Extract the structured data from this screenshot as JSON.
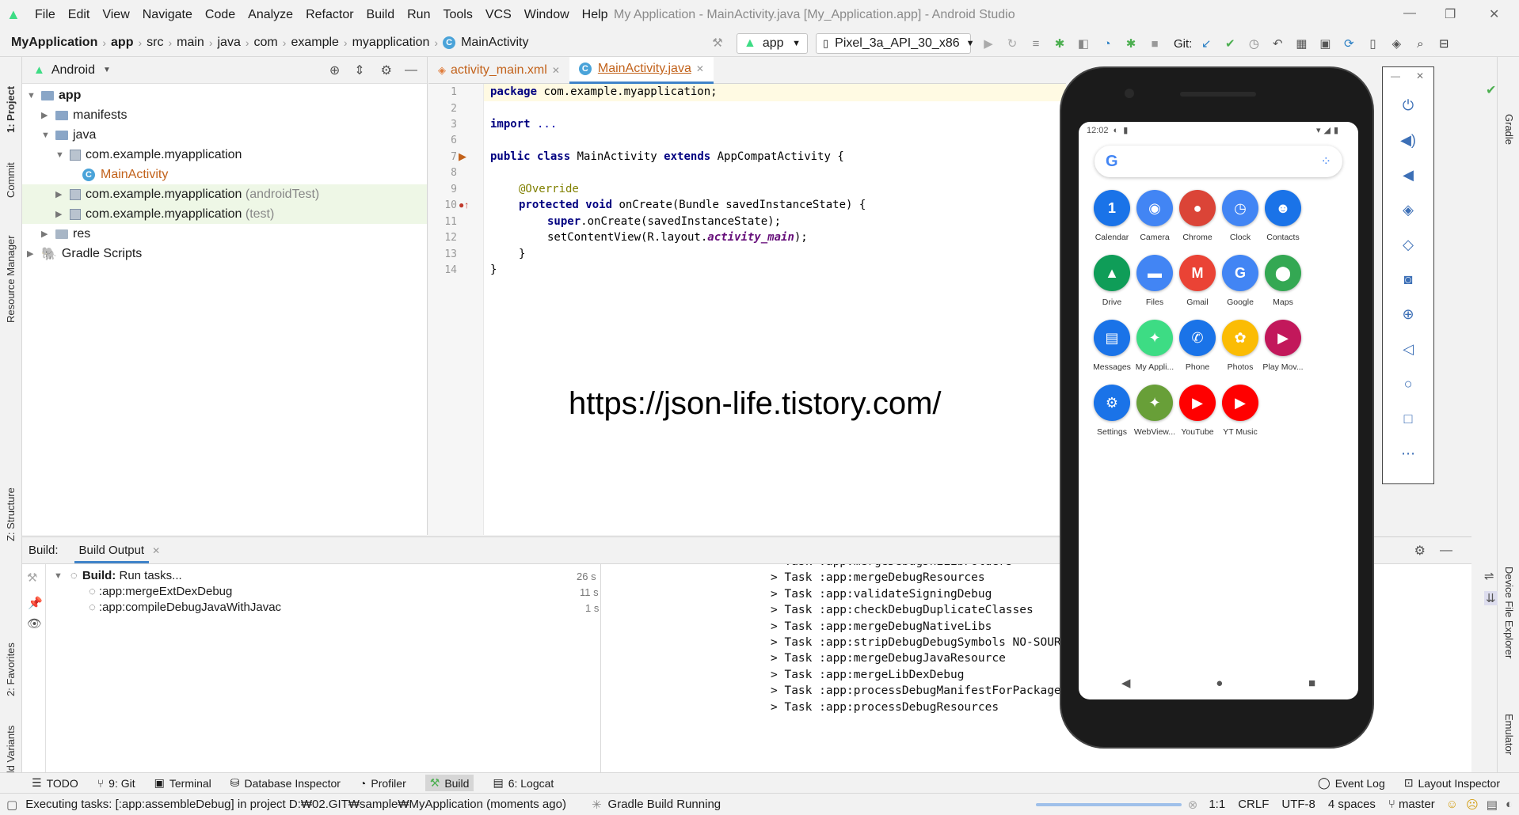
{
  "menu": [
    "File",
    "Edit",
    "View",
    "Navigate",
    "Code",
    "Analyze",
    "Refactor",
    "Build",
    "Run",
    "Tools",
    "VCS",
    "Window",
    "Help"
  ],
  "window_title": "My Application - MainActivity.java [My_Application.app] - Android Studio",
  "breadcrumb": [
    "MyApplication",
    "app",
    "src",
    "main",
    "java",
    "com",
    "example",
    "myapplication",
    "MainActivity"
  ],
  "toolbar": {
    "run_config": "app",
    "device": "Pixel_3a_API_30_x86",
    "git_label": "Git:"
  },
  "left_strip": [
    "1: Project",
    "Commit",
    "Resource Manager",
    "Z: Structure",
    "2: Favorites",
    "Build Variants"
  ],
  "right_strip": [
    "Gradle",
    "Device File Explorer",
    "Emulator"
  ],
  "project": {
    "view": "Android",
    "tree": [
      {
        "label": "app",
        "suffix": ""
      },
      {
        "label": "manifests",
        "suffix": ""
      },
      {
        "label": "java",
        "suffix": ""
      },
      {
        "label": "com.example.myapplication",
        "suffix": ""
      },
      {
        "label": "MainActivity",
        "suffix": ""
      },
      {
        "label": "com.example.myapplication",
        "suffix": "(androidTest)"
      },
      {
        "label": "com.example.myapplication",
        "suffix": "(test)"
      },
      {
        "label": "res",
        "suffix": ""
      },
      {
        "label": "Gradle Scripts",
        "suffix": ""
      }
    ]
  },
  "editor": {
    "tabs": [
      "activity_main.xml",
      "MainActivity.java"
    ],
    "line_numbers": [
      "1",
      "2",
      "3",
      "6",
      "7",
      "8",
      "9",
      "10",
      "11",
      "12",
      "13",
      "14"
    ],
    "code": {
      "l1_kw": "package",
      "l1": " com.example.myapplication;",
      "l3_kw": "import",
      "l3": " ...",
      "l7_kw1": "public class",
      "l7a": " MainActivity ",
      "l7_kw2": "extends",
      "l7b": " AppCompatActivity {",
      "l9": "@Override",
      "l10_kw": "protected void",
      "l10": " onCreate(Bundle savedInstanceState) {",
      "l11_kw": "super",
      "l11": ".onCreate(savedInstanceState);",
      "l12a": "setContentView(R.layout.",
      "l12_it": "activity_main",
      "l12b": ");",
      "l13": "}",
      "l14": "}"
    },
    "watermark": "https://json-life.tistory.com/"
  },
  "build": {
    "panel_label": "Build:",
    "tab": "Build Output",
    "tasks": [
      {
        "label": "Build:",
        "detail": "Run tasks...",
        "time": "26 s"
      },
      {
        "label": ":app:mergeExtDexDebug",
        "time": "11 s"
      },
      {
        "label": ":app:compileDebugJavaWithJavac",
        "time": "1 s"
      }
    ],
    "output": [
      "> Task :app:mergeDebugJniLibFolders",
      "> Task :app:mergeDebugResources",
      "> Task :app:validateSigningDebug",
      "> Task :app:checkDebugDuplicateClasses",
      "> Task :app:mergeDebugNativeLibs",
      "> Task :app:stripDebugDebugSymbols NO-SOURCE",
      "> Task :app:mergeDebugJavaResource",
      "> Task :app:mergeLibDexDebug",
      "> Task :app:processDebugManifestForPackage",
      "> Task :app:processDebugResources"
    ]
  },
  "tool_tabs": [
    "TODO",
    "9: Git",
    "Terminal",
    "Database Inspector",
    "Profiler",
    "Build",
    "6: Logcat"
  ],
  "tool_tabs_right": [
    "Event Log",
    "Layout Inspector"
  ],
  "status": {
    "message": "Executing tasks: [:app:assembleDebug] in project D:₩02.GIT₩sample₩MyApplication (moments ago)",
    "gradle": "Gradle Build Running",
    "position": "1:1",
    "line_sep": "CRLF",
    "encoding": "UTF-8",
    "indent": "4 spaces",
    "branch": "master"
  },
  "phone": {
    "time": "12:02",
    "apps": [
      {
        "name": "Calendar",
        "color": "#1a73e8",
        "glyph": "1"
      },
      {
        "name": "Camera",
        "color": "#4285f4",
        "glyph": "◉"
      },
      {
        "name": "Chrome",
        "color": "#db4437",
        "glyph": "●"
      },
      {
        "name": "Clock",
        "color": "#4285f4",
        "glyph": "◷"
      },
      {
        "name": "Contacts",
        "color": "#1a73e8",
        "glyph": "☻"
      },
      {
        "name": "Drive",
        "color": "#0f9d58",
        "glyph": "▲"
      },
      {
        "name": "Files",
        "color": "#4285f4",
        "glyph": "▬"
      },
      {
        "name": "Gmail",
        "color": "#ea4335",
        "glyph": "M"
      },
      {
        "name": "Google",
        "color": "#4285f4",
        "glyph": "G"
      },
      {
        "name": "Maps",
        "color": "#34a853",
        "glyph": "⬤"
      },
      {
        "name": "Messages",
        "color": "#1a73e8",
        "glyph": "▤"
      },
      {
        "name": "My Appli...",
        "color": "#3ddc84",
        "glyph": "✦"
      },
      {
        "name": "Phone",
        "color": "#1a73e8",
        "glyph": "✆"
      },
      {
        "name": "Photos",
        "color": "#fbbc04",
        "glyph": "✿"
      },
      {
        "name": "Play Mov...",
        "color": "#c2185b",
        "glyph": "▶"
      },
      {
        "name": "Settings",
        "color": "#1a73e8",
        "glyph": "⚙"
      },
      {
        "name": "WebView...",
        "color": "#689f38",
        "glyph": "✦"
      },
      {
        "name": "YouTube",
        "color": "#ff0000",
        "glyph": "▶"
      },
      {
        "name": "YT Music",
        "color": "#ff0000",
        "glyph": "▶"
      }
    ]
  }
}
